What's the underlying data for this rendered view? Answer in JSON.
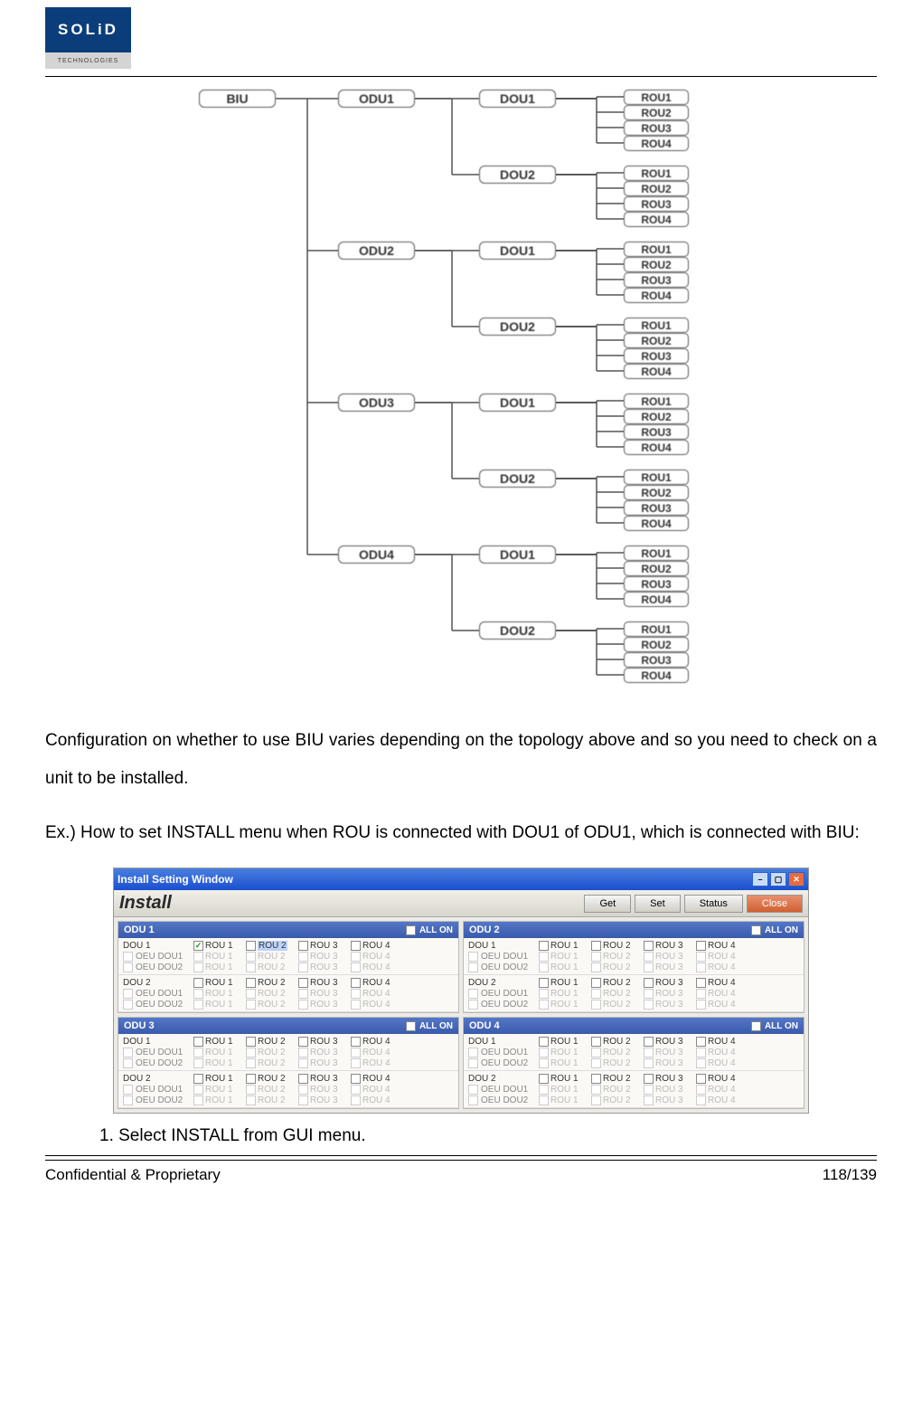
{
  "logo": {
    "top": "SOLiD",
    "bottom": "TECHNOLOGIES"
  },
  "tree": {
    "root": "BIU",
    "odus": [
      {
        "label": "ODU1",
        "dous": [
          {
            "label": "DOU1",
            "rous": [
              "ROU1",
              "ROU2",
              "ROU3",
              "ROU4"
            ]
          },
          {
            "label": "DOU2",
            "rous": [
              "ROU1",
              "ROU2",
              "ROU3",
              "ROU4"
            ]
          }
        ]
      },
      {
        "label": "ODU2",
        "dous": [
          {
            "label": "DOU1",
            "rous": [
              "ROU1",
              "ROU2",
              "ROU3",
              "ROU4"
            ]
          },
          {
            "label": "DOU2",
            "rous": [
              "ROU1",
              "ROU2",
              "ROU3",
              "ROU4"
            ]
          }
        ]
      },
      {
        "label": "ODU3",
        "dous": [
          {
            "label": "DOU1",
            "rous": [
              "ROU1",
              "ROU2",
              "ROU3",
              "ROU4"
            ]
          },
          {
            "label": "DOU2",
            "rous": [
              "ROU1",
              "ROU2",
              "ROU3",
              "ROU4"
            ]
          }
        ]
      },
      {
        "label": "ODU4",
        "dous": [
          {
            "label": "DOU1",
            "rous": [
              "ROU1",
              "ROU2",
              "ROU3",
              "ROU4"
            ]
          },
          {
            "label": "DOU2",
            "rous": [
              "ROU1",
              "ROU2",
              "ROU3",
              "ROU4"
            ]
          }
        ]
      }
    ]
  },
  "paragraph1": "Configuration on whether to use BIU varies depending on the topology above and so you need to check on a unit to be installed.",
  "paragraph2": "Ex.) How to set INSTALL menu when ROU is connected with DOU1 of ODU1, which is connected with BIU:",
  "window": {
    "title": "Install Setting Window",
    "heading": "Install",
    "buttons": {
      "get": "Get",
      "set": "Set",
      "status": "Status",
      "close": "Close"
    },
    "allon_label": "ALL ON",
    "rou_labels": [
      "ROU 1",
      "ROU 2",
      "ROU 3",
      "ROU 4"
    ],
    "dou_block_labels": {
      "dou1": "DOU 1",
      "dou2": "DOU 2",
      "oeu1": "OEU DOU1",
      "oeu2": "OEU DOU2"
    },
    "panels": [
      {
        "head": "ODU 1",
        "blocks": [
          {
            "name": "DOU 1",
            "rows": [
              {
                "lbl": "DOU 1",
                "rous": [
                  {
                    "on": true,
                    "checked": true
                  },
                  {
                    "on": true,
                    "hl": true
                  },
                  {
                    "on": true
                  },
                  {
                    "on": true
                  }
                ]
              },
              {
                "lbl": "OEU DOU1",
                "dim": true,
                "rous": [
                  {},
                  {},
                  {},
                  {}
                ]
              },
              {
                "lbl": "OEU DOU2",
                "dim": true,
                "rous": [
                  {},
                  {},
                  {},
                  {}
                ]
              }
            ]
          },
          {
            "name": "DOU 2",
            "rows": [
              {
                "lbl": "DOU 2",
                "rous": [
                  {
                    "on": true
                  },
                  {
                    "on": true
                  },
                  {
                    "on": true
                  },
                  {
                    "on": true
                  }
                ]
              },
              {
                "lbl": "OEU DOU1",
                "dim": true,
                "rous": [
                  {},
                  {},
                  {},
                  {}
                ]
              },
              {
                "lbl": "OEU DOU2",
                "dim": true,
                "rous": [
                  {},
                  {},
                  {},
                  {}
                ]
              }
            ]
          }
        ]
      },
      {
        "head": "ODU 2",
        "blocks": [
          {
            "name": "DOU 1",
            "rows": [
              {
                "lbl": "DOU 1",
                "rous": [
                  {
                    "on": true
                  },
                  {
                    "on": true
                  },
                  {
                    "on": true
                  },
                  {
                    "on": true
                  }
                ]
              },
              {
                "lbl": "OEU DOU1",
                "dim": true,
                "rous": [
                  {},
                  {},
                  {},
                  {}
                ]
              },
              {
                "lbl": "OEU DOU2",
                "dim": true,
                "rous": [
                  {},
                  {},
                  {},
                  {}
                ]
              }
            ]
          },
          {
            "name": "DOU 2",
            "rows": [
              {
                "lbl": "DOU 2",
                "rous": [
                  {
                    "on": true
                  },
                  {
                    "on": true
                  },
                  {
                    "on": true
                  },
                  {
                    "on": true
                  }
                ]
              },
              {
                "lbl": "OEU DOU1",
                "dim": true,
                "rous": [
                  {},
                  {},
                  {},
                  {}
                ]
              },
              {
                "lbl": "OEU DOU2",
                "dim": true,
                "rous": [
                  {},
                  {},
                  {},
                  {}
                ]
              }
            ]
          }
        ]
      },
      {
        "head": "ODU 3",
        "blocks": [
          {
            "name": "DOU 1",
            "rows": [
              {
                "lbl": "DOU 1",
                "rous": [
                  {
                    "on": true
                  },
                  {
                    "on": true
                  },
                  {
                    "on": true
                  },
                  {
                    "on": true
                  }
                ]
              },
              {
                "lbl": "OEU DOU1",
                "dim": true,
                "rous": [
                  {},
                  {},
                  {},
                  {}
                ]
              },
              {
                "lbl": "OEU DOU2",
                "dim": true,
                "rous": [
                  {},
                  {},
                  {},
                  {}
                ]
              }
            ]
          },
          {
            "name": "DOU 2",
            "rows": [
              {
                "lbl": "DOU 2",
                "rous": [
                  {
                    "on": true
                  },
                  {
                    "on": true
                  },
                  {
                    "on": true
                  },
                  {
                    "on": true
                  }
                ]
              },
              {
                "lbl": "OEU DOU1",
                "dim": true,
                "rous": [
                  {},
                  {},
                  {},
                  {}
                ]
              },
              {
                "lbl": "OEU DOU2",
                "dim": true,
                "rous": [
                  {},
                  {},
                  {},
                  {}
                ]
              }
            ]
          }
        ]
      },
      {
        "head": "ODU 4",
        "blocks": [
          {
            "name": "DOU 1",
            "rows": [
              {
                "lbl": "DOU 1",
                "rous": [
                  {
                    "on": true
                  },
                  {
                    "on": true
                  },
                  {
                    "on": true
                  },
                  {
                    "on": true
                  }
                ]
              },
              {
                "lbl": "OEU DOU1",
                "dim": true,
                "rous": [
                  {},
                  {},
                  {},
                  {}
                ]
              },
              {
                "lbl": "OEU DOU2",
                "dim": true,
                "rous": [
                  {},
                  {},
                  {},
                  {}
                ]
              }
            ]
          },
          {
            "name": "DOU 2",
            "rows": [
              {
                "lbl": "DOU 2",
                "rous": [
                  {
                    "on": true
                  },
                  {
                    "on": true
                  },
                  {
                    "on": true
                  },
                  {
                    "on": true
                  }
                ]
              },
              {
                "lbl": "OEU DOU1",
                "dim": true,
                "rous": [
                  {},
                  {},
                  {},
                  {}
                ]
              },
              {
                "lbl": "OEU DOU2",
                "dim": true,
                "rous": [
                  {},
                  {},
                  {},
                  {}
                ]
              }
            ]
          }
        ]
      }
    ]
  },
  "step1": "1. Select INSTALL from GUI menu.",
  "footer": {
    "left": "Confidential & Proprietary",
    "right": "118/139"
  }
}
